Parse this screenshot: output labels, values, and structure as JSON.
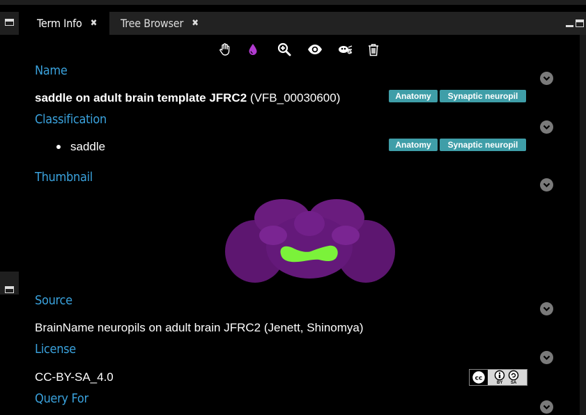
{
  "tabs": [
    {
      "label": "Term Info",
      "close": "✖",
      "active": true
    },
    {
      "label": "Tree Browser",
      "close": "✖",
      "active": false
    }
  ],
  "toolbar_icons": [
    "hand-icon",
    "color-drop-icon",
    "zoom-in-icon",
    "eye-icon",
    "bug-icon",
    "trash-icon"
  ],
  "accent": "#3aa2dd",
  "drop_color": "#b23bd0",
  "sections": {
    "name": {
      "heading": "Name",
      "title_bold": "saddle on adult brain template JFRC2",
      "title_id": "(VFB_00030600)",
      "badges": [
        "Anatomy",
        "Synaptic neuropil"
      ]
    },
    "classification": {
      "heading": "Classification",
      "items": [
        "saddle"
      ],
      "badges": [
        "Anatomy",
        "Synaptic neuropil"
      ]
    },
    "thumbnail": {
      "heading": "Thumbnail"
    },
    "source": {
      "heading": "Source",
      "text": "BrainName neuropils on adult brain JFRC2 (Jenett, Shinomya)"
    },
    "license": {
      "heading": "License",
      "text": "CC-BY-SA_4.0",
      "badge_labels": [
        "BY",
        "SA"
      ]
    },
    "query_for": {
      "heading": "Query For"
    }
  }
}
